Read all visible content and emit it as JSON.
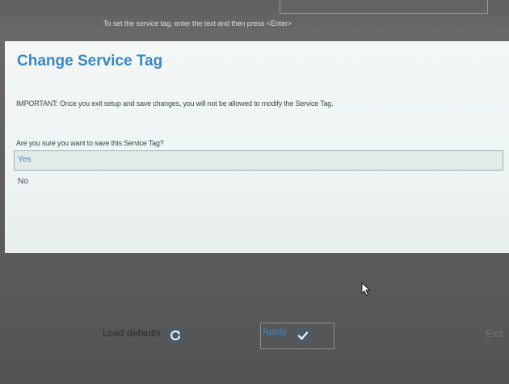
{
  "header": {
    "hint": "To set the service tag, enter the text and then press <Enter>"
  },
  "dialog": {
    "title": "Change Service Tag",
    "important": "IMPORTANT: Once you exit setup and save changes, you will not be allowed to modify the Service Tag.",
    "question": "Are you sure you want to save this Service Tag?",
    "options": [
      {
        "label": "Yes",
        "selected": true
      },
      {
        "label": "No",
        "selected": false
      }
    ]
  },
  "footer": {
    "load_defaults": "Load defaults",
    "apply": "Apply",
    "exit": "Exit"
  },
  "icons": {
    "load_defaults": "refresh-icon",
    "apply": "checkmark-icon",
    "pointer": "mouse-pointer-icon"
  },
  "colors": {
    "accent": "#3a86c6",
    "dialog_bg": "#f0f5f4",
    "bar_bg": "#5e5e5e"
  }
}
